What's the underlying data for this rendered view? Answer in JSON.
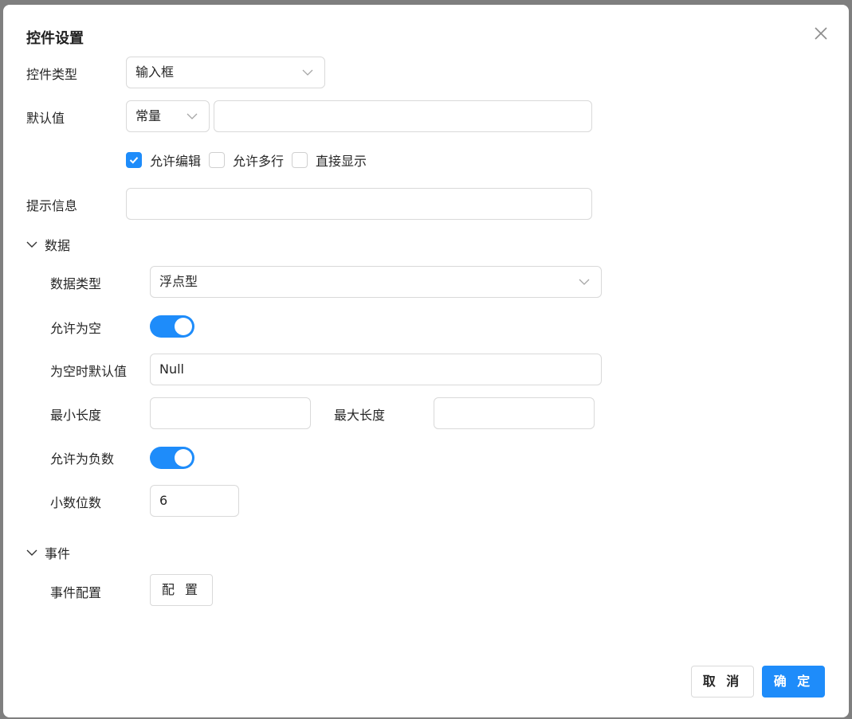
{
  "dialog": {
    "title": "控件设置",
    "cancel_label": "取 消",
    "ok_label": "确 定"
  },
  "form": {
    "control_type_label": "控件类型",
    "control_type_value": "输入框",
    "default_label": "默认值",
    "default_mode_value": "常量",
    "default_value": "",
    "checkboxes": [
      {
        "label": "允许编辑",
        "checked": true
      },
      {
        "label": "允许多行",
        "checked": false
      },
      {
        "label": "直接显示",
        "checked": false
      }
    ],
    "hint_label": "提示信息",
    "hint_value": ""
  },
  "data_section": {
    "title": "数据",
    "data_type_label": "数据类型",
    "data_type_value": "浮点型",
    "allow_empty_label": "允许为空",
    "allow_empty_on": true,
    "empty_default_label": "为空时默认值",
    "empty_default_value": "Null",
    "min_length_label": "最小长度",
    "min_length_value": "",
    "max_length_label": "最大长度",
    "max_length_value": "",
    "allow_negative_label": "允许为负数",
    "allow_negative_on": true,
    "decimals_label": "小数位数",
    "decimals_value": "6"
  },
  "event_section": {
    "title": "事件",
    "config_label": "事件配置",
    "config_button": "配 置"
  },
  "colors": {
    "accent": "#1e8cfa",
    "border": "#d9d9d9",
    "backdrop": "#7f7f7f"
  }
}
